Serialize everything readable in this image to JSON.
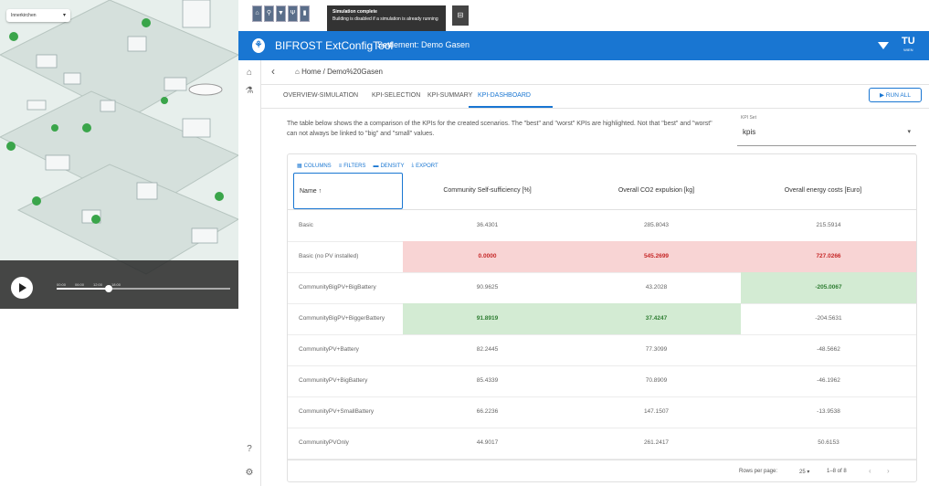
{
  "simulation": {
    "selector_value": "Innerkirchen",
    "time_labels": [
      "00:00",
      "06:00",
      "12:00",
      "18:00"
    ],
    "progress": 0.3
  },
  "toast": {
    "title": "Simulation complete",
    "message": "Building is disabled if a simulation is already running"
  },
  "app": {
    "title": "BIFROST ExtConfigTool",
    "settlement": "Settlement: Demo Gasen",
    "logo_text": "TU",
    "logo_sub": "WIEN",
    "accent_color": "#1976d2"
  },
  "breadcrumb": "Home / Demo%20Gasen",
  "tabs": [
    "OVERVIEW-SIMULATION",
    "KPI-SELECTION",
    "KPI-SUMMARY",
    "KPI-DASHBOARD"
  ],
  "active_tab": "KPI-DASHBOARD",
  "run_all_label": "RUN ALL",
  "description": "The table below shows the a comparison of the KPIs for the created scenarios. The \"best\" and \"worst\" KPIs are highlighted. Not that \"best\" and \"worst\" can not always be linked to \"big\" and \"small\" values.",
  "kpi_set": {
    "label": "KPI Set",
    "value": "kpis"
  },
  "grid_toolbar": {
    "columns": "COLUMNS",
    "filters": "FILTERS",
    "density": "DENSITY",
    "export": "EXPORT"
  },
  "table": {
    "columns": [
      "Name ↑",
      "Community Self-sufficiency [%]",
      "Overall CO2 expulsion [kg]",
      "Overall energy costs [Euro]"
    ],
    "rows": [
      {
        "name": "Basic",
        "values": [
          "36.4301",
          "285.8043",
          "215.5914"
        ],
        "hl": [
          "",
          "",
          ""
        ]
      },
      {
        "name": "Basic (no PV installed)",
        "values": [
          "0.0000",
          "545.2699",
          "727.0266"
        ],
        "hl": [
          "red",
          "red",
          "red"
        ]
      },
      {
        "name": "CommunityBigPV+BigBattery",
        "values": [
          "90.9625",
          "43.2028",
          "-205.0067"
        ],
        "hl": [
          "",
          "",
          "green"
        ]
      },
      {
        "name": "CommunityBigPV+BiggerBattery",
        "values": [
          "91.8919",
          "37.4247",
          "-204.5631"
        ],
        "hl": [
          "green",
          "green",
          ""
        ]
      },
      {
        "name": "CommunityPV+Battery",
        "values": [
          "82.2445",
          "77.3099",
          "-48.5662"
        ],
        "hl": [
          "",
          "",
          ""
        ]
      },
      {
        "name": "CommunityPV+BigBattery",
        "values": [
          "85.4339",
          "70.8909",
          "-46.1962"
        ],
        "hl": [
          "",
          "",
          ""
        ]
      },
      {
        "name": "CommunityPV+SmallBattery",
        "values": [
          "66.2236",
          "147.1507",
          "-13.9538"
        ],
        "hl": [
          "",
          "",
          ""
        ]
      },
      {
        "name": "CommunityPVOnly",
        "values": [
          "44.9017",
          "261.2417",
          "50.6153"
        ],
        "hl": [
          "",
          "",
          ""
        ]
      }
    ]
  },
  "pagination": {
    "rows_per_page_label": "Rows per page:",
    "rows_per_page": "25",
    "range": "1–8 of 8"
  }
}
